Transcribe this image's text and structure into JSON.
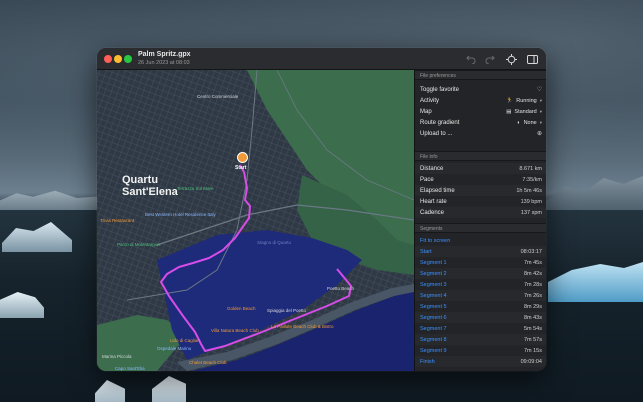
{
  "window": {
    "title": "Palm Spritz.gpx",
    "subtitle": "26 Jun 2023 at 08:03"
  },
  "map": {
    "city_label_line1": "Quartu",
    "city_label_line2": "Sant'Elena",
    "start_label": "Start",
    "labels": [
      "Centro Commerciale",
      "Best Western Hotel Residence Italy",
      "Trivia Restaurant",
      "Parco di Molentargius",
      "Stagno di Quartu",
      "Poetto Beach",
      "Spiaggia del Poetto",
      "Marina Piccola",
      "Capo Sant'Elia",
      "Golden Beach",
      "La Paillote Beach Club & Bistro",
      "Villa Natura Beach Club",
      "Lido di Cagliari",
      "Ospedale Marino",
      "Chalet Beach Club",
      "Terrazza Sul Mare"
    ]
  },
  "toolbar": {
    "undo_icon": "undo-icon",
    "redo_icon": "redo-icon",
    "locate_icon": "crosshair-icon",
    "sidebar_icon": "sidebar-toggle-icon"
  },
  "preferences": {
    "header": "File preferences",
    "toggle_favorite": "Toggle favorite",
    "activity_label": "Activity",
    "activity_value": "Running",
    "map_label": "Map",
    "map_value": "Standard",
    "route_gradient_label": "Route gradient",
    "route_gradient_value": "None",
    "upload_label": "Upload to ..."
  },
  "file_info": {
    "header": "File info",
    "rows": [
      {
        "label": "Distance",
        "value": "8.671 km"
      },
      {
        "label": "Pace",
        "value": "7:35/km"
      },
      {
        "label": "Elapsed time",
        "value": "1h 5m 46s"
      },
      {
        "label": "Heart rate",
        "value": "139 bpm"
      },
      {
        "label": "Cadence",
        "value": "137 spm"
      }
    ]
  },
  "segments": {
    "header": "Segments",
    "fit_label": "Fit to screen",
    "rows": [
      {
        "label": "Start",
        "value": "08:03:17"
      },
      {
        "label": "Segment 1",
        "value": "7m 45s"
      },
      {
        "label": "Segment 2",
        "value": "8m 42s"
      },
      {
        "label": "Segment 3",
        "value": "7m 28s"
      },
      {
        "label": "Segment 4",
        "value": "7m 26s"
      },
      {
        "label": "Segment 5",
        "value": "8m 29s"
      },
      {
        "label": "Segment 6",
        "value": "8m 43s"
      },
      {
        "label": "Segment 7",
        "value": "5m 54s"
      },
      {
        "label": "Segment 8",
        "value": "7m 57s"
      },
      {
        "label": "Segment 9",
        "value": "7m 15s"
      },
      {
        "label": "Finish",
        "value": "09:09:04"
      }
    ]
  },
  "colors": {
    "accent": "#3b91ff",
    "route": "#d64ce8",
    "water": "#1e2a7a",
    "land": "#3a6e4c"
  }
}
